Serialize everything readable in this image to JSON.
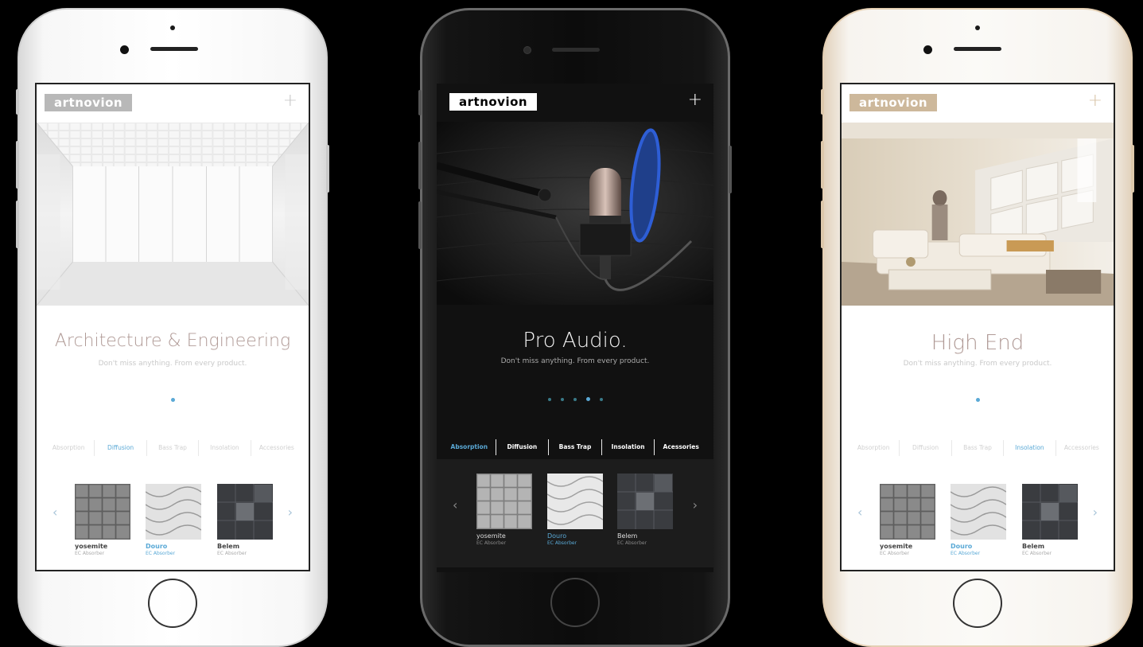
{
  "colors": {
    "accent": "#5aa9d6",
    "background": "#000000"
  },
  "phones": [
    {
      "finish": "silver",
      "brand": "artnovion",
      "menu_icon": "plus-icon",
      "headline": "Architecture & Engineering",
      "subline": "Don't miss anything. From every product.",
      "tabs": [
        "Absorption",
        "Diffusion",
        "Bass Trap",
        "Insolation",
        "Accessories"
      ],
      "active_tab": 1,
      "products": [
        {
          "name": "yosemite",
          "subtitle": "EC Absorber"
        },
        {
          "name": "Douro",
          "subtitle": "EC Absorber"
        },
        {
          "name": "Belem",
          "subtitle": "EC Absorber"
        }
      ]
    },
    {
      "finish": "black",
      "brand": "artnovion",
      "menu_icon": "plus-icon",
      "headline": "Pro Audio.",
      "subline": "Don't miss anything. From every product.",
      "tabs": [
        "Absorption",
        "Diffusion",
        "Bass Trap",
        "Insolation",
        "Acessories"
      ],
      "active_tab": 0,
      "products": [
        {
          "name": "yosemite",
          "subtitle": "EC Absorber"
        },
        {
          "name": "Douro",
          "subtitle": "EC Absorber"
        },
        {
          "name": "Belem",
          "subtitle": "EC Absorber"
        }
      ]
    },
    {
      "finish": "gold",
      "brand": "artnovion",
      "menu_icon": "plus-icon",
      "headline": "High End",
      "subline": "Don't miss anything. From every product.",
      "tabs": [
        "Absorption",
        "Diffusion",
        "Bass Trap",
        "Insolation",
        "Accessories"
      ],
      "active_tab": 3,
      "products": [
        {
          "name": "yosemite",
          "subtitle": "EC Absorber"
        },
        {
          "name": "Douro",
          "subtitle": "EC Absorber"
        },
        {
          "name": "Belem",
          "subtitle": "EC Absorber"
        }
      ]
    }
  ]
}
